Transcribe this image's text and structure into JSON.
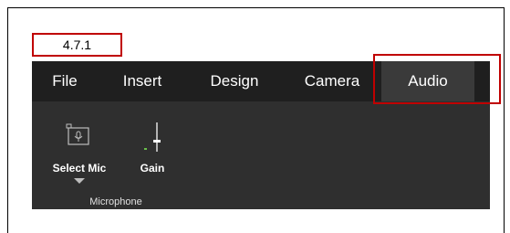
{
  "version_label": "4.7.1",
  "tabs": [
    {
      "label": "File",
      "active": false
    },
    {
      "label": "Insert",
      "active": false
    },
    {
      "label": "Design",
      "active": false
    },
    {
      "label": "Camera",
      "active": false
    },
    {
      "label": "Audio",
      "active": true
    }
  ],
  "tools": {
    "select_mic": {
      "label": "Select Mic",
      "icon": "microphone-icon"
    },
    "gain": {
      "label": "Gain",
      "icon": "slider-icon"
    }
  },
  "group": {
    "label": "Microphone"
  },
  "colors": {
    "highlight": "#c00000",
    "ribbon_bg": "#2f2f2f",
    "tabs_bg": "#1f1f1f",
    "active_tab_bg": "#3a3a3a",
    "gain_accent": "#6abf4b"
  }
}
